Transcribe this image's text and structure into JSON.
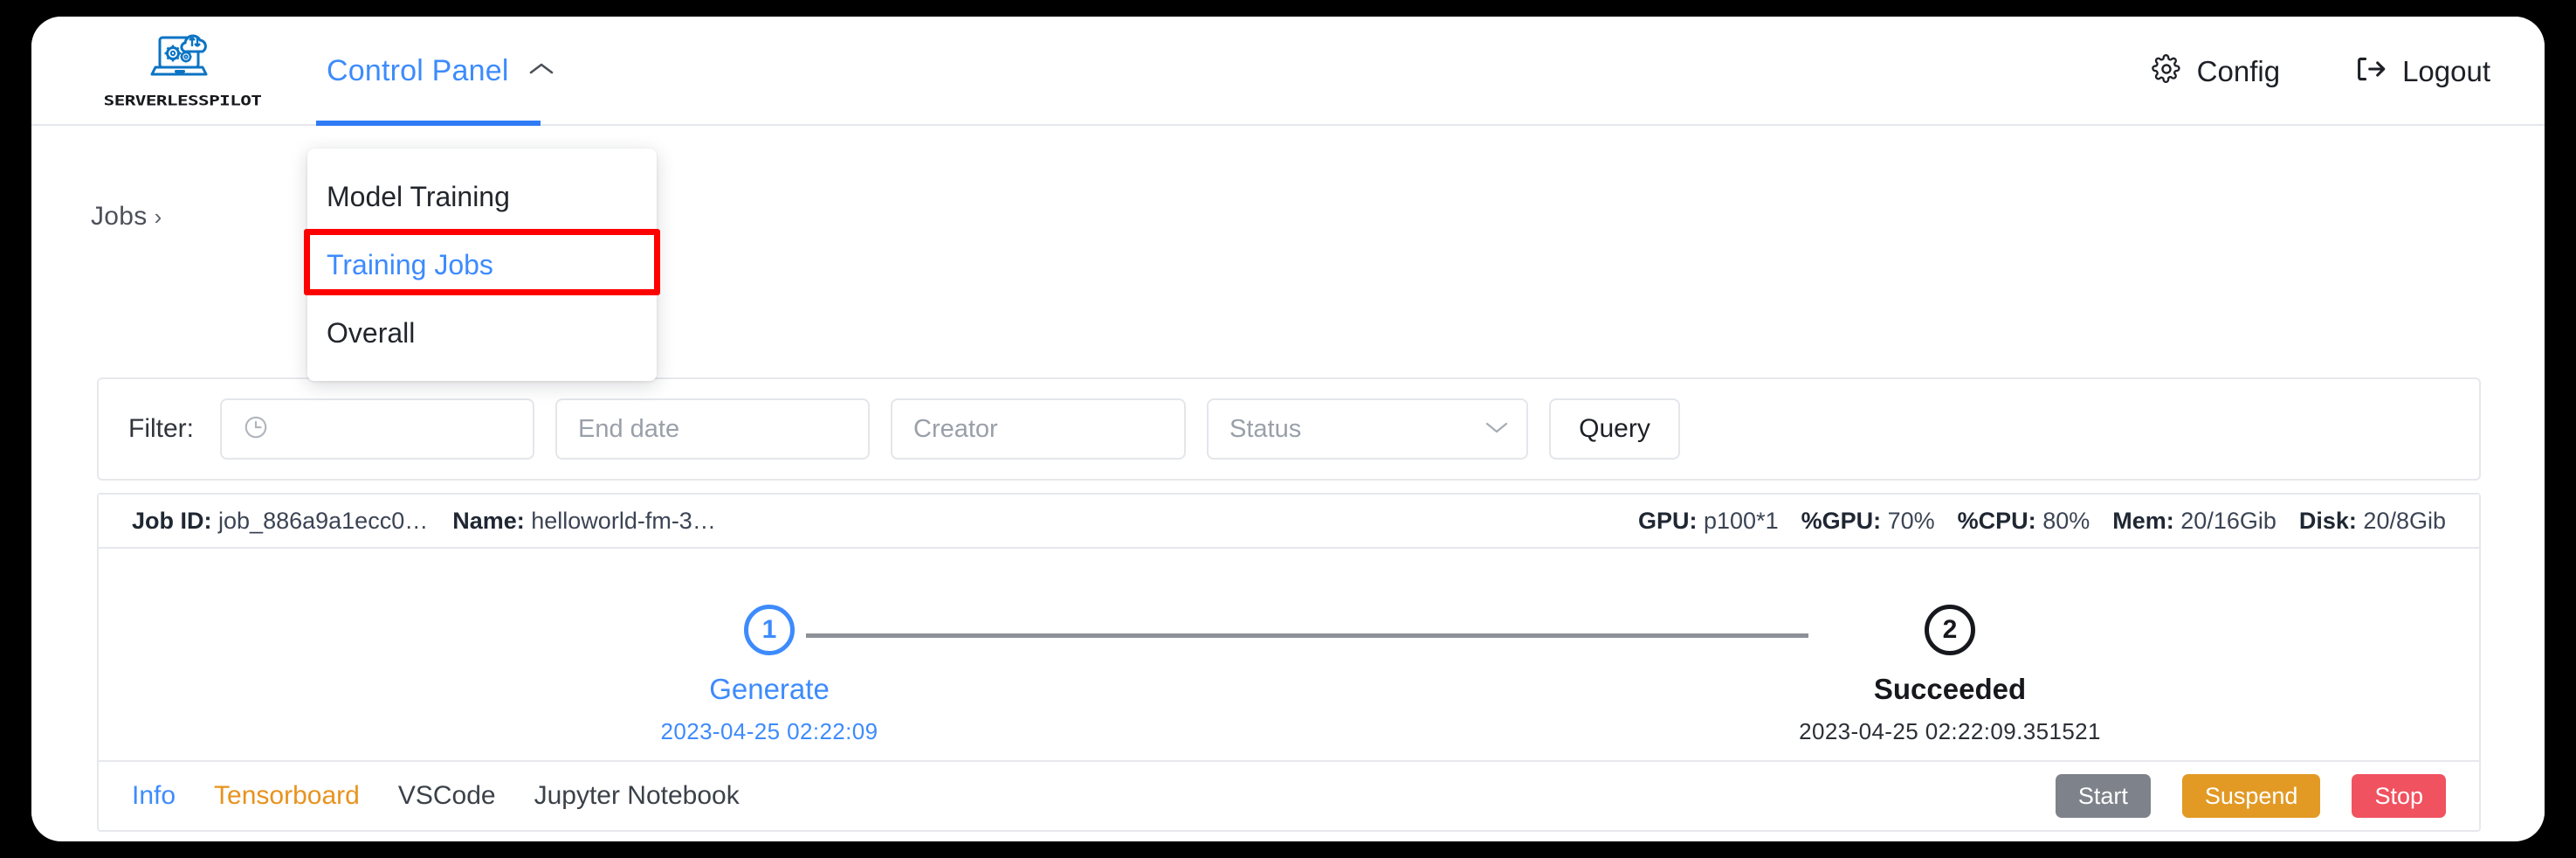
{
  "brand": {
    "wordmark": "SERVERLESSPILOT",
    "logo_icon": "laptop-cloud-gears-icon"
  },
  "topnav": {
    "active_item": "Control Panel",
    "caret_icon": "chevron-up-icon",
    "right_items": [
      {
        "label": "Config",
        "icon": "gear-icon"
      },
      {
        "label": "Logout",
        "icon": "logout-icon"
      }
    ]
  },
  "dropdown": {
    "items": [
      {
        "label": "Model Training",
        "active": false
      },
      {
        "label": "Training Jobs",
        "active": true
      },
      {
        "label": "Overall",
        "active": false
      }
    ],
    "highlight_color": "#ff0000",
    "highlighted_item": "Training Jobs"
  },
  "breadcrumb": {
    "root": "Jobs",
    "separator": "›"
  },
  "filter": {
    "label": "Filter:",
    "start_date_placeholder": "",
    "start_date_icon": "clock-icon",
    "end_date_placeholder": "End date",
    "creator_placeholder": "Creator",
    "status_placeholder": "Status",
    "status_caret_icon": "chevron-down-icon",
    "query_button": "Query"
  },
  "job": {
    "id_label": "Job ID:",
    "id_value": "job_886a9a1ecc0…",
    "name_label": "Name:",
    "name_value": "helloworld-fm-3…",
    "resources": [
      {
        "label": "GPU:",
        "value": "p100*1"
      },
      {
        "label": "%GPU:",
        "value": "70%"
      },
      {
        "label": "%CPU:",
        "value": "80%"
      },
      {
        "label": "Mem:",
        "value": "20/16Gib"
      },
      {
        "label": "Disk:",
        "value": "20/8Gib"
      }
    ],
    "steps": [
      {
        "number": "1",
        "title": "Generate",
        "time": "2023-04-25 02:22:09",
        "state": "active"
      },
      {
        "number": "2",
        "title": "Succeeded",
        "time": "2023-04-25 02:22:09.351521",
        "state": "done"
      }
    ],
    "tabs": [
      {
        "label": "Info",
        "color": "blue"
      },
      {
        "label": "Tensorboard",
        "color": "orange"
      },
      {
        "label": "VSCode",
        "color": "dark"
      },
      {
        "label": "Jupyter Notebook",
        "color": "dark"
      }
    ],
    "actions": [
      {
        "label": "Start",
        "color": "#7e828a"
      },
      {
        "label": "Suspend",
        "color": "#e29a25"
      },
      {
        "label": "Stop",
        "color": "#f05260"
      }
    ]
  },
  "theme": {
    "accent_blue": "#3d8bfd",
    "orange": "#e8921d",
    "red": "#f05260",
    "grey": "#7e828a"
  }
}
